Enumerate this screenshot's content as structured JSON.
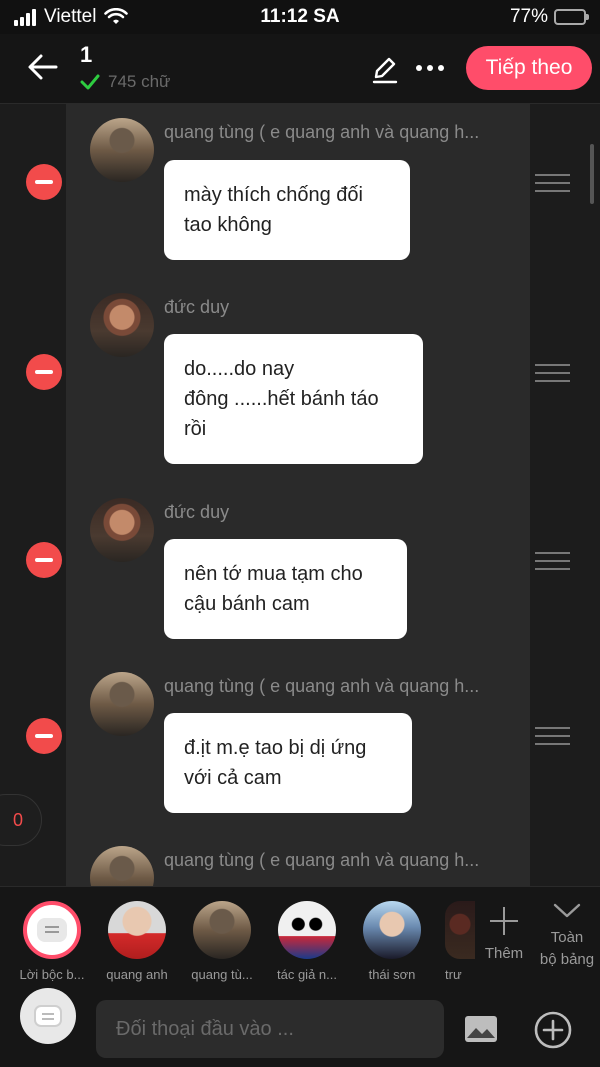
{
  "status_bar": {
    "carrier": "Viettel",
    "time": "11:12 SA",
    "battery": "77%",
    "battery_level": 0.77
  },
  "header": {
    "title": "1",
    "word_count": "745 chữ",
    "next_label": "Tiếp theo",
    "accent_color": "#ff4d6a"
  },
  "messages": [
    {
      "sender": "quang tùng ( e quang anh và quang h...",
      "text": "mày thích chống đối\ntao không"
    },
    {
      "sender": "đức duy",
      "text": "do.....do nay\nđông ......hết bánh táo\nrồi"
    },
    {
      "sender": "đức duy",
      "text": "nên tớ mua tạm cho\ncậu bánh cam"
    },
    {
      "sender": "quang tùng ( e quang anh và quang h...",
      "text": "đ.ịt m.ẹ tao bị dị ứng\nvới cả cam"
    },
    {
      "sender": "quang tùng ( e quang anh và quang h..."
    }
  ],
  "counter": "0",
  "characters": [
    {
      "label": "Lời bộc b..."
    },
    {
      "label": "quang anh"
    },
    {
      "label": "quang tù..."
    },
    {
      "label": "tác giả n..."
    },
    {
      "label": "thái sơn"
    },
    {
      "label": "trư"
    }
  ],
  "add_label": "Thêm",
  "full_board_label_1": "Toàn",
  "full_board_label_2": "bộ bảng",
  "input": {
    "placeholder": "Đối thoại đầu vào ..."
  }
}
